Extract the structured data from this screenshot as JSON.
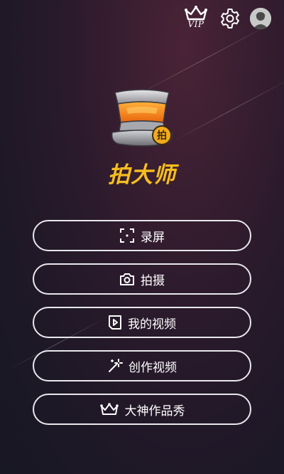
{
  "header": {
    "vip_label": "VIP",
    "icons": [
      "crown-vip-icon",
      "gear-icon",
      "avatar"
    ]
  },
  "brand": {
    "app_name": "拍大师",
    "logo_badge": "拍",
    "accent_color": "#f6be1e"
  },
  "menu": {
    "items": [
      {
        "label": "录屏",
        "icon": "screen-record-icon"
      },
      {
        "label": "拍摄",
        "icon": "camera-icon"
      },
      {
        "label": "我的视频",
        "icon": "video-file-icon"
      },
      {
        "label": "创作视频",
        "icon": "magic-wand-icon"
      },
      {
        "label": "大神作品秀",
        "icon": "crown-icon"
      }
    ]
  }
}
